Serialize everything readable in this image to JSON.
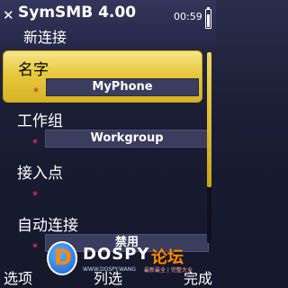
{
  "titlebar": {
    "close_glyph": "✕",
    "app_title": "SymSMB 4.00",
    "subtitle": "新连接",
    "clock": "00:59"
  },
  "items": [
    {
      "label": "名字",
      "required": "*",
      "value": "MyPhone",
      "selected": true
    },
    {
      "label": "工作组",
      "required": "*",
      "value": "Workgroup",
      "selected": false
    },
    {
      "label": "接入点",
      "required": "*",
      "value": "",
      "selected": false
    },
    {
      "label": "自动连接",
      "required": "*",
      "value": "禁用",
      "selected": false
    }
  ],
  "softkeys": {
    "left": "选项",
    "middle": "列选",
    "right": "完成"
  },
  "watermark": {
    "brand": "DOSPY",
    "brand_cn": "论坛",
    "url": "WWW.DOSPY.WANG",
    "tag": "最新最全 | 完整大全"
  },
  "colors": {
    "accent": "#e6c93c",
    "required_star": "#ff3a6e",
    "background": "#1a1c33"
  }
}
